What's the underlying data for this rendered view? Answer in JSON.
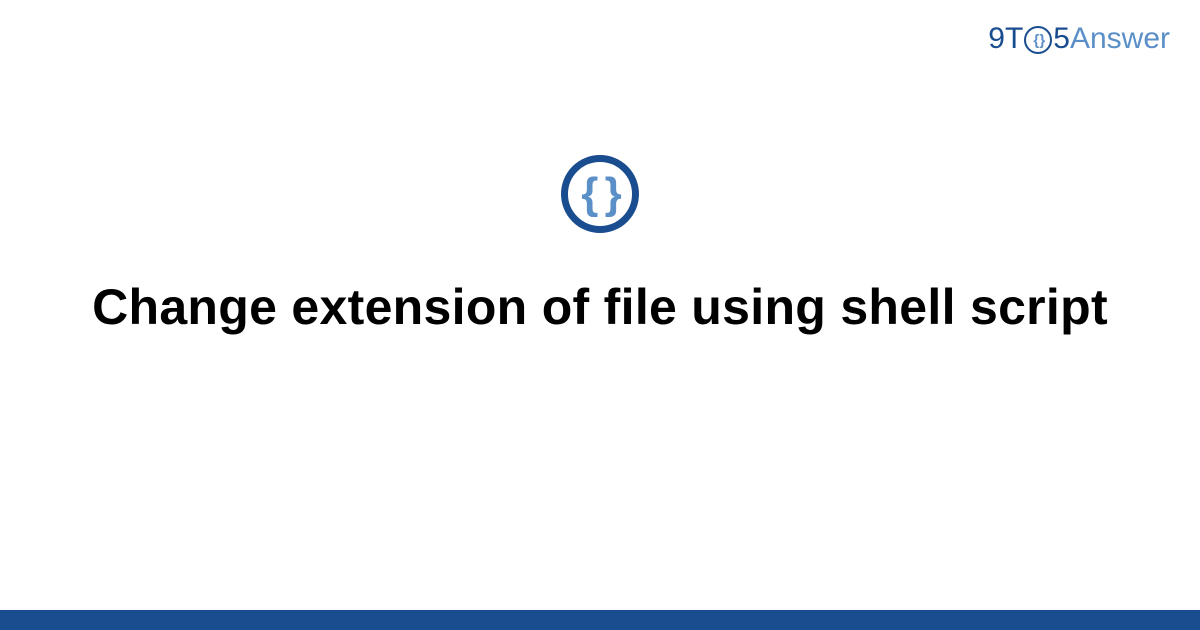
{
  "logo": {
    "nine": "9",
    "t": "T",
    "five": "5",
    "answer": "Answer",
    "braces": "{ }"
  },
  "center_icon": {
    "braces": "{ }"
  },
  "title": "Change extension of file using shell script"
}
